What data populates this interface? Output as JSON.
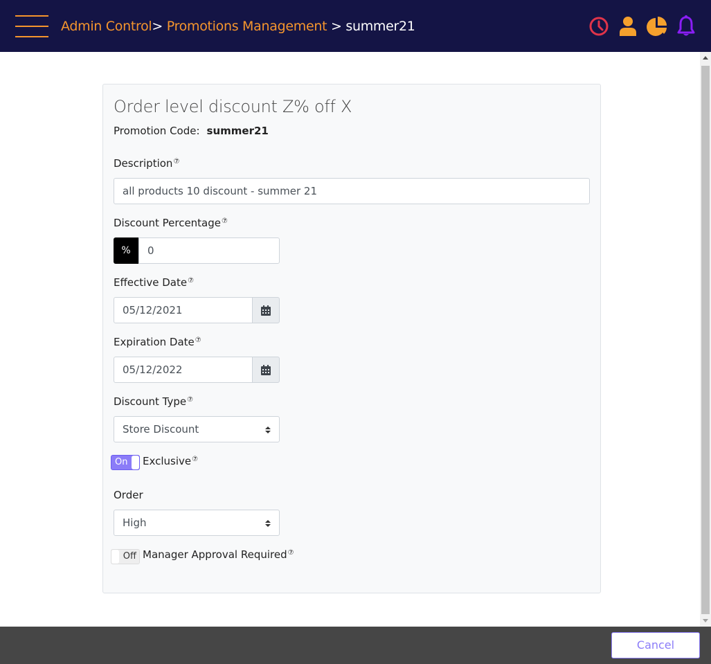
{
  "header": {
    "menu_icon": "hamburger-icon",
    "breadcrumb": [
      {
        "label": "Admin Control"
      },
      {
        "label": "Promotions Management"
      },
      {
        "label": "summer21"
      }
    ],
    "separator": ">",
    "icons": [
      {
        "name": "clock-icon",
        "color": "#e0344a"
      },
      {
        "name": "user-icon",
        "color": "#f5a02d"
      },
      {
        "name": "pie-chart-icon",
        "color": "#f5a02d"
      },
      {
        "name": "bell-icon",
        "color": "#8a1ef5"
      }
    ]
  },
  "form": {
    "title": "Order level discount Z% off X",
    "promotion_code_label": "Promotion Code:",
    "promotion_code": "summer21",
    "help_glyph": "⑦",
    "description": {
      "label": "Description",
      "value": "all products 10 discount - summer 21"
    },
    "discount_percentage": {
      "label": "Discount Percentage",
      "addon": "%",
      "value": "0"
    },
    "effective_date": {
      "label": "Effective Date",
      "value": "05/12/2021"
    },
    "expiration_date": {
      "label": "Expiration Date",
      "value": "05/12/2022"
    },
    "discount_type": {
      "label": "Discount Type",
      "selected": "Store Discount"
    },
    "exclusive": {
      "label": "Exclusive",
      "state_label": "On",
      "checked": true
    },
    "order": {
      "label": "Order",
      "selected": "High"
    },
    "manager_approval": {
      "label": "Manager Approval Required",
      "state_label": "Off",
      "checked": false
    }
  },
  "footer": {
    "cancel_label": "Cancel"
  },
  "colors": {
    "topbar": "#141445",
    "accent_orange": "#f5952d",
    "accent_purple": "#8b7cf8",
    "footer": "#464646"
  }
}
